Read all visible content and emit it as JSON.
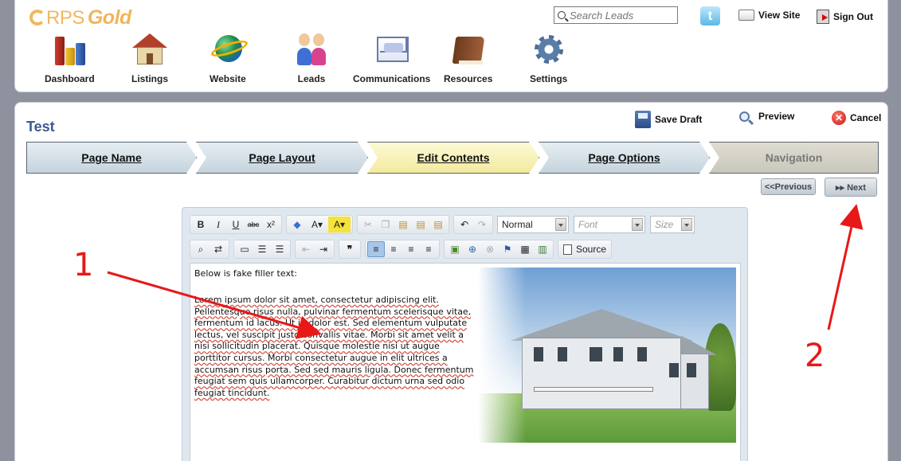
{
  "header": {
    "logo": {
      "prefix": "RPS",
      "suffix": "Gold"
    },
    "search": {
      "placeholder": "Search Leads"
    },
    "twitter_glyph": "t",
    "view_site_label": "View Site",
    "sign_out_label": "Sign Out",
    "nav": [
      {
        "label": "Dashboard",
        "icon": "dashboard-icon"
      },
      {
        "label": "Listings",
        "icon": "house-icon"
      },
      {
        "label": "Website",
        "icon": "globe-icon"
      },
      {
        "label": "Leads",
        "icon": "people-icon"
      },
      {
        "label": "Communications",
        "icon": "envelope-icon"
      },
      {
        "label": "Resources",
        "icon": "book-icon"
      },
      {
        "label": "Settings",
        "icon": "gear-icon"
      }
    ]
  },
  "page": {
    "title": "Test",
    "actions": {
      "save_draft": "Save Draft",
      "preview": "Preview",
      "cancel": "Cancel"
    },
    "steps": [
      {
        "label": "Page Name",
        "state": "done"
      },
      {
        "label": "Page Layout",
        "state": "done"
      },
      {
        "label": "Edit Contents",
        "state": "active"
      },
      {
        "label": "Page Options",
        "state": "todo"
      },
      {
        "label": "Navigation",
        "state": "disabled"
      }
    ],
    "pager": {
      "previous": "<<Previous",
      "next": "▸▸ Next"
    }
  },
  "editor": {
    "toolbar": {
      "format_value": "Normal",
      "font_placeholder": "Font",
      "size_placeholder": "Size",
      "source_label": "Source"
    },
    "content": {
      "intro": "Below is fake filler text:",
      "body": "Lorem ipsum dolor sit amet, consectetur adipiscing elit. Pellentesque risus nulla, pulvinar fermentum scelerisque vitae, fermentum id lacus. Ut in dolor est. Sed elementum vulputate lectus, vel suscipit justo convallis vitae. Morbi sit amet velit a nisi sollicitudin placerat. Quisque molestie nisi ut augue porttitor cursus. Morbi consectetur augue in elit ultrices a accumsan risus porta. Sed sed mauris ligula. Donec fermentum feugiat sem quis ullamcorper. Curabitur dictum urna sed odio feugiat tincidunt."
    }
  },
  "annotations": {
    "one": "1",
    "two": "2",
    "color": "#e81818"
  }
}
